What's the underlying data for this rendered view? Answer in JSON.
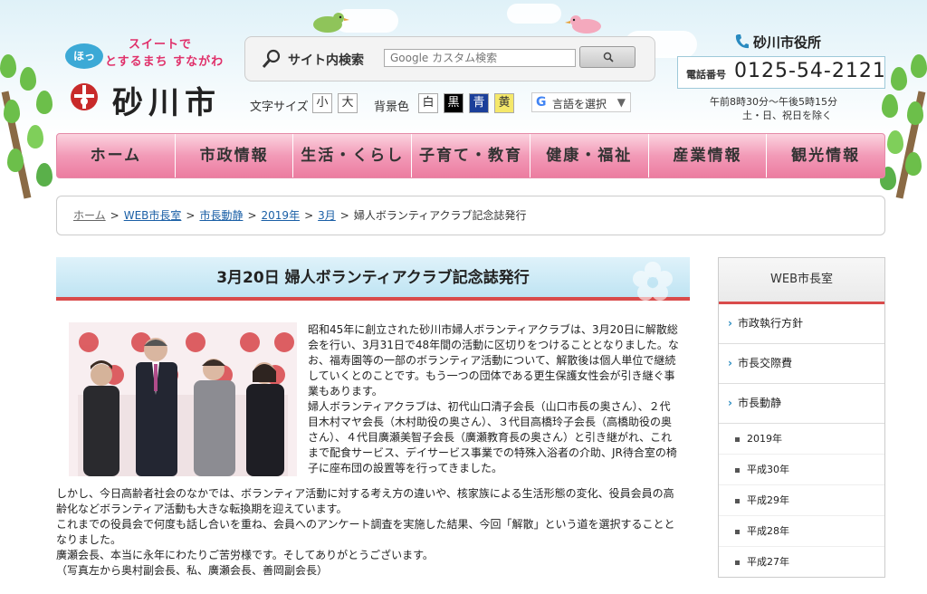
{
  "header": {
    "slogan_badge": "ほっ",
    "slogan_line1": "スイートで",
    "slogan_line2": "とするまち すながわ",
    "city_name": "砂川市"
  },
  "search": {
    "label": "サイト内検索",
    "placeholder": "Google カスタム検索"
  },
  "display_options": {
    "font_size_label": "文字サイズ",
    "font_small": "小",
    "font_large": "大",
    "bg_label": "背景色",
    "bg_white": "白",
    "bg_black": "黒",
    "bg_blue": "青",
    "bg_yellow": "黄",
    "language_select": "言語を選択"
  },
  "city_hall": {
    "name": "砂川市役所",
    "tel_label": "電話番号",
    "tel_number": "0125-54-2121",
    "hours_line1": "午前8時30分～午後5時15分",
    "hours_line2": "土・日、祝日を除く"
  },
  "nav": {
    "items": [
      "ホーム",
      "市政情報",
      "生活・くらし",
      "子育て・教育",
      "健康・福祉",
      "産業情報",
      "観光情報"
    ]
  },
  "breadcrumb": {
    "items": [
      "ホーム",
      "WEB市長室",
      "市長動静",
      "2019年",
      "3月"
    ],
    "current": "婦人ボランティアクラブ記念誌発行"
  },
  "article": {
    "title": "3月20日 婦人ボランティアクラブ記念誌発行",
    "para1": "昭和45年に創立された砂川市婦人ボランティアクラブは、3月20日に解散総会を行い、3月31日で48年間の活動に区切りをつけることとなりました。なお、福寿園等の一部のボランティア活動について、解散後は個人単位で継続していくとのことです。もう一つの団体である更生保護女性会が引き継ぐ事業もあります。",
    "para2": "婦人ボランティアクラブは、初代山口清子会長（山口市長の奥さん）、２代目木村マヤ会長（木村助役の奥さん）、３代目高橋玲子会長（高橋助役の奥さん）、４代目廣瀬美智子会長（廣瀬教育長の奥さん）と引き継がれ、これまで配食サービス、デイサービス事業での特殊入浴者の介助、JR待合室の椅子に座布団の設置等を行ってきました。",
    "para3": "しかし、今日高齢者社会のなかでは、ボランティア活動に対する考え方の違いや、核家族による生活形態の変化、役員会員の高齢化などボランティア活動も大きな転換期を迎えています。",
    "para4": "これまでの役員会で何度も話し合いを重ね、会員へのアンケート調査を実施した結果、今回「解散」という道を選択することとなりました。",
    "para5": "廣瀬会長、本当に永年にわたりご苦労様です。そしてありがとうございます。",
    "caption": "（写真左から奥村副会長、私、廣瀬会長、善岡副会長）"
  },
  "sidebar": {
    "title": "WEB市長室",
    "items": [
      "市政執行方針",
      "市長交際費",
      "市長動静"
    ],
    "sub_items": [
      "2019年",
      "平成30年",
      "平成29年",
      "平成28年",
      "平成27年"
    ]
  },
  "colors": {
    "accent_red": "#d94b4b",
    "nav_pink": "#f29ab7",
    "link_blue": "#1a5fa6",
    "sky_blue": "#dff1f8"
  }
}
